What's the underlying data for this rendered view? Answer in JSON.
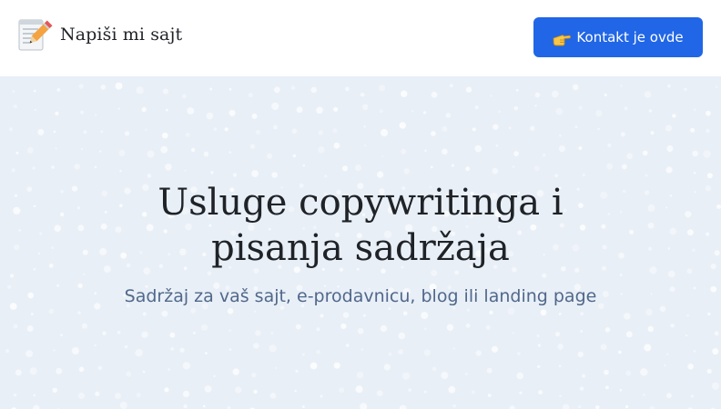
{
  "header": {
    "brand_icon": "memo-pencil-icon",
    "brand_name": "Napiši mi sajt",
    "cta_icon": "pointing-hand-icon",
    "cta_label": "Kontakt je ovde"
  },
  "hero": {
    "title": "Usluge copywritinga i pisanja sadržaja",
    "subtitle": "Sadržaj za vaš sajt, e-prodavnicu, blog ili landing page"
  },
  "colors": {
    "accent": "#2166e6",
    "hero_background": "#e8eff7",
    "subtitle": "#51688a"
  }
}
